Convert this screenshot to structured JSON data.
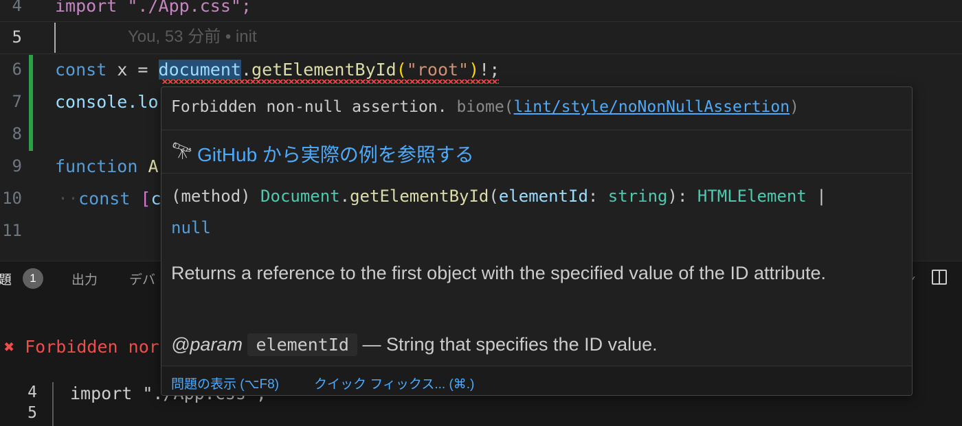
{
  "editor": {
    "lines": [
      {
        "num": "4",
        "text": "import \"./App.css\";"
      },
      {
        "num": "5",
        "blame": "You, 53 分前 • init"
      },
      {
        "num": "6",
        "tokens": [
          "const",
          " x = ",
          "document",
          ".",
          "getElementById",
          "(",
          "\"root\"",
          ")",
          "!;"
        ]
      },
      {
        "num": "7",
        "text": "console.lo"
      },
      {
        "num": "8",
        "text": ""
      },
      {
        "num": "9",
        "tokens": [
          "function",
          " A"
        ]
      },
      {
        "num": "10",
        "tokens": [
          "··",
          "const",
          " [",
          "c"
        ]
      },
      {
        "num": "11",
        "text": ""
      }
    ]
  },
  "hover": {
    "diagnostic": {
      "message": "Forbidden non-null assertion.",
      "source": "biome(",
      "rule_link": "lint/style/noNonNullAssertion",
      "source_close": ")"
    },
    "github": {
      "icon": "telescope-icon",
      "label": "GitHub から実際の例を参照する"
    },
    "signature": {
      "prefix": "(method) ",
      "class": "Document",
      "dot": ".",
      "method": "getElementById",
      "open": "(",
      "param": "elementId",
      "colon": ": ",
      "param_type": "string",
      "close": "): ",
      "return_type": "HTMLElement",
      "pipe": " |",
      "null": "null"
    },
    "description": "Returns a reference to the first object with the specified value of the ID attribute.",
    "param_doc": {
      "tag": "@param",
      "name": "elementId",
      "text": " — String that specifies the ID value."
    },
    "status_bar": {
      "view_problem": "問題の表示 (⌥F8)",
      "quick_fix": "クイック フィックス... (⌘.)"
    }
  },
  "panel": {
    "tabs": {
      "problems_partial": "題",
      "problems_count": "1",
      "output": "出力",
      "debug_partial": "デバ"
    },
    "problem_partial": "Forbidden nor",
    "preview": [
      {
        "num": "4",
        "text": "import \"./App.css\";"
      },
      {
        "num": "5",
        "text": ""
      }
    ]
  },
  "colors": {
    "link": "#4daafc",
    "error": "#f14c4c",
    "added": "#2ea043"
  }
}
